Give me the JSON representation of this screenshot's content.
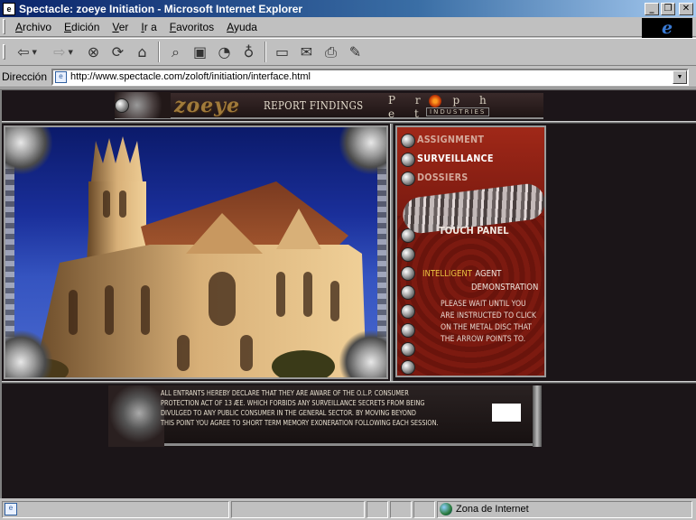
{
  "window": {
    "title": "Spectacle: zoeye Initiation - Microsoft Internet Explorer",
    "minimize": "_",
    "maximize": "❐",
    "close": "✕"
  },
  "menu": {
    "items": [
      "Archivo",
      "Edición",
      "Ver",
      "Ir a",
      "Favoritos",
      "Ayuda"
    ]
  },
  "toolbar": {
    "buttons": [
      "back-icon",
      "forward-icon",
      "stop-icon",
      "refresh-icon",
      "home-icon",
      "search-icon",
      "favorites-icon",
      "history-icon",
      "channels-icon",
      "fullscreen-icon",
      "mail-icon",
      "print-icon",
      "edit-icon"
    ]
  },
  "address": {
    "label": "Dirección",
    "url": "http://www.spectacle.com/zoloft/initiation/interface.html"
  },
  "page": {
    "brand": "zoeye",
    "report_findings": "REPORT FINDINGS",
    "prophet_letters": "P  r",
    "prophet_rest": "p h e t",
    "prophet_sub": "INDUSTRIES",
    "nav": {
      "assignment": "ASSIGNMENT",
      "surveillance": "SURVEILLANCE",
      "dossiers": "DOSSIERS"
    },
    "touch_panel": "TOUCH PANEL",
    "intelligent": "INTELLIGENT",
    "agent": "AGENT",
    "demonstration": "DEMONSTRATION",
    "instructions": [
      "PLEASE WAIT UNTIL YOU",
      "ARE INSTRUCTED TO CLICK",
      "ON THE METAL DISC THAT",
      "THE ARROW POINTS TO."
    ],
    "legal": [
      "ALL ENTRANTS HEREBY DECLARE THAT THEY ARE AWARE OF THE O.L.P. CONSUMER",
      "PROTECTION ACT OF 13 ÆE. WHICH FORBIDS ANY SURVEILLANCE SECRETS FROM BEING",
      "DIVULGED TO ANY PUBLIC CONSUMER IN THE GENERAL SECTOR. BY MOVING BEYOND",
      "THIS POINT YOU AGREE TO SHORT TERM MEMORY EXONERATION FOLLOWING EACH SESSION."
    ]
  },
  "status": {
    "zone": "Zona de Internet"
  },
  "colors": {
    "title_bar": "#0a246a",
    "panel_red": "#7c1a10",
    "page_bg": "#1b1518",
    "intelligent_yellow": "#e8c040"
  }
}
